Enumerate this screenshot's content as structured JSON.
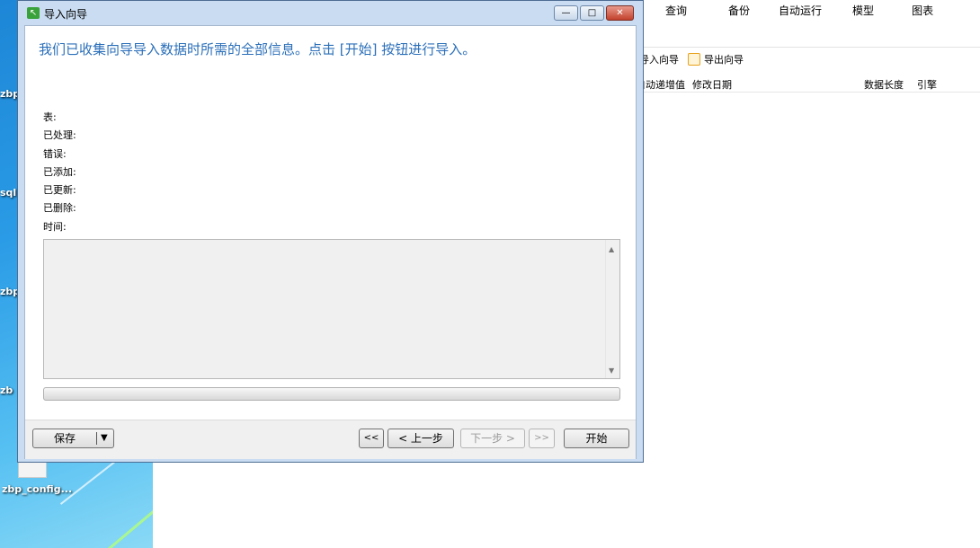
{
  "desktop": {
    "icons": [
      "zbp",
      "sql",
      "zbp",
      "zb",
      "zbp_config..."
    ]
  },
  "background_app": {
    "menu": [
      "查询",
      "备份",
      "自动运行",
      "模型",
      "图表"
    ],
    "toolbar": [
      "导入向导",
      "导出向导"
    ],
    "columns": [
      "自动递增值",
      "修改日期",
      "数据长度",
      "引擎"
    ]
  },
  "dialog": {
    "title": "导入向导",
    "info": "我们已收集向导导入数据时所需的全部信息。点击 [开始] 按钮进行导入。",
    "fields": {
      "table": "表:",
      "processed": "已处理:",
      "errors": "错误:",
      "added": "已添加:",
      "updated": "已更新:",
      "deleted": "已删除:",
      "time": "时间:"
    },
    "progress_percent": 0,
    "buttons": {
      "save": "保存",
      "first": "<<",
      "prev": "< 上一步",
      "next": "下一步 >",
      "last": ">>",
      "start": "开始"
    }
  }
}
